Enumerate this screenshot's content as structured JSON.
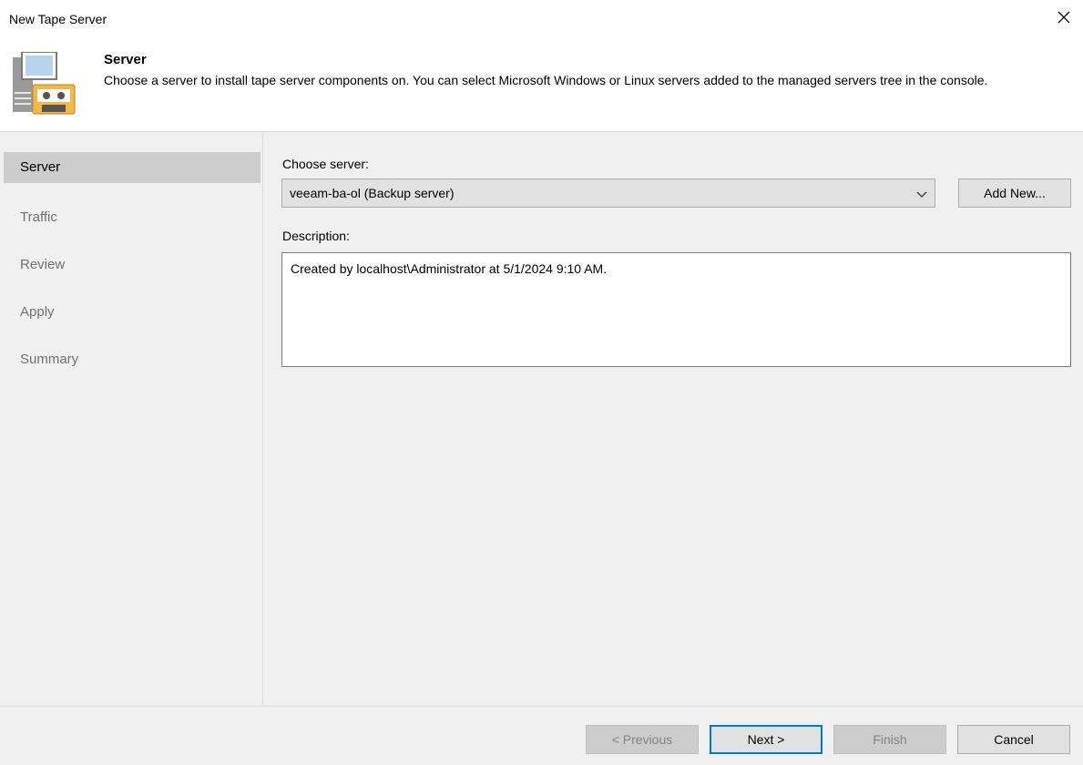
{
  "window": {
    "title": "New Tape Server",
    "close_icon": "close-icon"
  },
  "header": {
    "title": "Server",
    "description": "Choose a server to install tape server components on. You can select Microsoft Windows or Linux servers added to the managed servers tree in the console.",
    "icon": "tape-server-icon"
  },
  "sidebar": {
    "steps": [
      {
        "label": "Server",
        "active": true
      },
      {
        "label": "Traffic",
        "active": false
      },
      {
        "label": "Review",
        "active": false
      },
      {
        "label": "Apply",
        "active": false
      },
      {
        "label": "Summary",
        "active": false
      }
    ]
  },
  "form": {
    "choose_server_label": "Choose server:",
    "server_value": "veeam-ba-ol (Backup server)",
    "add_new_label": "Add New...",
    "description_label": "Description:",
    "description_value": "Created by localhost\\Administrator at 5/1/2024 9:10 AM."
  },
  "footer": {
    "previous_label": "< Previous",
    "next_label": "Next >",
    "finish_label": "Finish",
    "cancel_label": "Cancel"
  },
  "colors": {
    "accent": "#0078d7",
    "active_step_bg": "#cccccc",
    "panel_bg": "#f0f0f0"
  }
}
